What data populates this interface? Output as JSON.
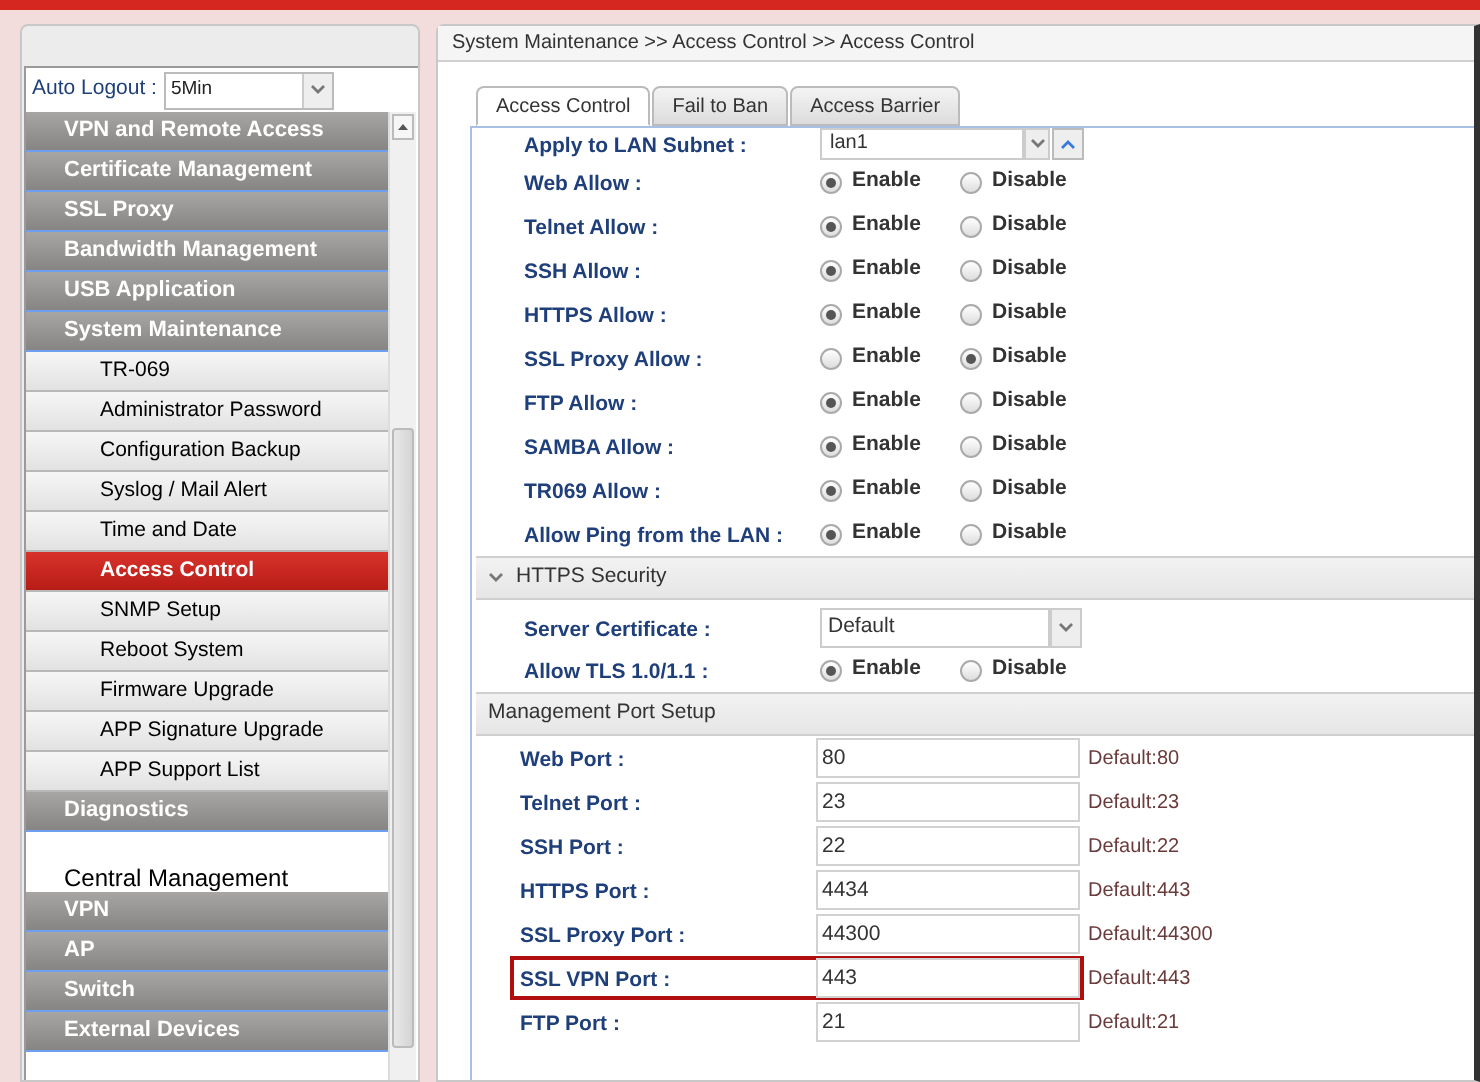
{
  "auto_logout": {
    "label": "Auto Logout :",
    "value": "5Min"
  },
  "sidebar": {
    "items": [
      {
        "kind": "group",
        "label": "VPN and Remote Access",
        "selected": false
      },
      {
        "kind": "group",
        "label": "Certificate Management",
        "selected": false
      },
      {
        "kind": "group",
        "label": "SSL Proxy",
        "selected": false
      },
      {
        "kind": "group",
        "label": "Bandwidth Management",
        "selected": false
      },
      {
        "kind": "group",
        "label": "USB Application",
        "selected": false
      },
      {
        "kind": "group",
        "label": "System Maintenance",
        "selected": false
      },
      {
        "kind": "item",
        "label": "TR-069",
        "selected": false
      },
      {
        "kind": "item",
        "label": "Administrator Password",
        "selected": false
      },
      {
        "kind": "item",
        "label": "Configuration Backup",
        "selected": false
      },
      {
        "kind": "item",
        "label": "Syslog / Mail Alert",
        "selected": false
      },
      {
        "kind": "item",
        "label": "Time and Date",
        "selected": false
      },
      {
        "kind": "item",
        "label": "Access Control",
        "selected": true
      },
      {
        "kind": "item",
        "label": "SNMP Setup",
        "selected": false
      },
      {
        "kind": "item",
        "label": "Reboot System",
        "selected": false
      },
      {
        "kind": "item",
        "label": "Firmware Upgrade",
        "selected": false
      },
      {
        "kind": "item",
        "label": "APP Signature Upgrade",
        "selected": false
      },
      {
        "kind": "item",
        "label": "APP Support List",
        "selected": false
      },
      {
        "kind": "group",
        "label": "Diagnostics",
        "selected": false
      },
      {
        "kind": "heading",
        "label": "Central Management"
      },
      {
        "kind": "group",
        "label": "VPN",
        "selected": false
      },
      {
        "kind": "group",
        "label": "AP",
        "selected": false
      },
      {
        "kind": "group",
        "label": "Switch",
        "selected": false
      },
      {
        "kind": "group",
        "label": "External Devices",
        "selected": false
      }
    ]
  },
  "breadcrumb": "System Maintenance >> Access Control >> Access Control",
  "tabs": [
    {
      "label": "Access Control",
      "selected": true
    },
    {
      "label": "Fail to Ban",
      "selected": false
    },
    {
      "label": "Access Barrier",
      "selected": false
    }
  ],
  "rows": [
    {
      "kind": "select",
      "label": "Apply to LAN Subnet :",
      "value": "lan1"
    },
    {
      "kind": "radio",
      "label": "Web Allow :",
      "options": [
        {
          "label": "Enable",
          "selected": true
        },
        {
          "label": "Disable",
          "selected": false
        }
      ]
    },
    {
      "kind": "radio",
      "label": "Telnet Allow :",
      "options": [
        {
          "label": "Enable",
          "selected": true
        },
        {
          "label": "Disable",
          "selected": false
        }
      ]
    },
    {
      "kind": "radio",
      "label": "SSH Allow :",
      "options": [
        {
          "label": "Enable",
          "selected": true
        },
        {
          "label": "Disable",
          "selected": false
        }
      ]
    },
    {
      "kind": "radio",
      "label": "HTTPS Allow :",
      "options": [
        {
          "label": "Enable",
          "selected": true
        },
        {
          "label": "Disable",
          "selected": false
        }
      ]
    },
    {
      "kind": "radio",
      "label": "SSL Proxy Allow :",
      "options": [
        {
          "label": "Enable",
          "selected": false
        },
        {
          "label": "Disable",
          "selected": true
        }
      ]
    },
    {
      "kind": "radio",
      "label": "FTP Allow :",
      "options": [
        {
          "label": "Enable",
          "selected": true
        },
        {
          "label": "Disable",
          "selected": false
        }
      ]
    },
    {
      "kind": "radio",
      "label": "SAMBA Allow :",
      "options": [
        {
          "label": "Enable",
          "selected": true
        },
        {
          "label": "Disable",
          "selected": false
        }
      ]
    },
    {
      "kind": "radio",
      "label": "TR069 Allow :",
      "options": [
        {
          "label": "Enable",
          "selected": true
        },
        {
          "label": "Disable",
          "selected": false
        }
      ]
    },
    {
      "kind": "radio",
      "label": "Allow Ping from the LAN :",
      "options": [
        {
          "label": "Enable",
          "selected": true
        },
        {
          "label": "Disable",
          "selected": false
        }
      ]
    },
    {
      "kind": "section",
      "label": "HTTPS Security",
      "expanded": true
    },
    {
      "kind": "dropdown",
      "label": "Server Certificate :",
      "value": "Default"
    },
    {
      "kind": "radio",
      "label": "Allow TLS 1.0/1.1 :",
      "options": [
        {
          "label": "Enable",
          "selected": true
        },
        {
          "label": "Disable",
          "selected": false
        }
      ]
    },
    {
      "kind": "section",
      "label": "Management Port Setup"
    },
    {
      "kind": "port",
      "label": "Web Port :",
      "value": "80",
      "default": "Default:80",
      "highlighted": false
    },
    {
      "kind": "port",
      "label": "Telnet Port :",
      "value": "23",
      "default": "Default:23",
      "highlighted": false
    },
    {
      "kind": "port",
      "label": "SSH Port :",
      "value": "22",
      "default": "Default:22",
      "highlighted": false
    },
    {
      "kind": "port",
      "label": "HTTPS Port :",
      "value": "4434",
      "default": "Default:443",
      "highlighted": false
    },
    {
      "kind": "port",
      "label": "SSL Proxy Port :",
      "value": "44300",
      "default": "Default:44300",
      "highlighted": false
    },
    {
      "kind": "port",
      "label": "SSL VPN Port :",
      "value": "443",
      "default": "Default:443",
      "highlighted": true
    },
    {
      "kind": "port",
      "label": "FTP Port :",
      "value": "21",
      "default": "Default:21",
      "highlighted": false
    }
  ]
}
